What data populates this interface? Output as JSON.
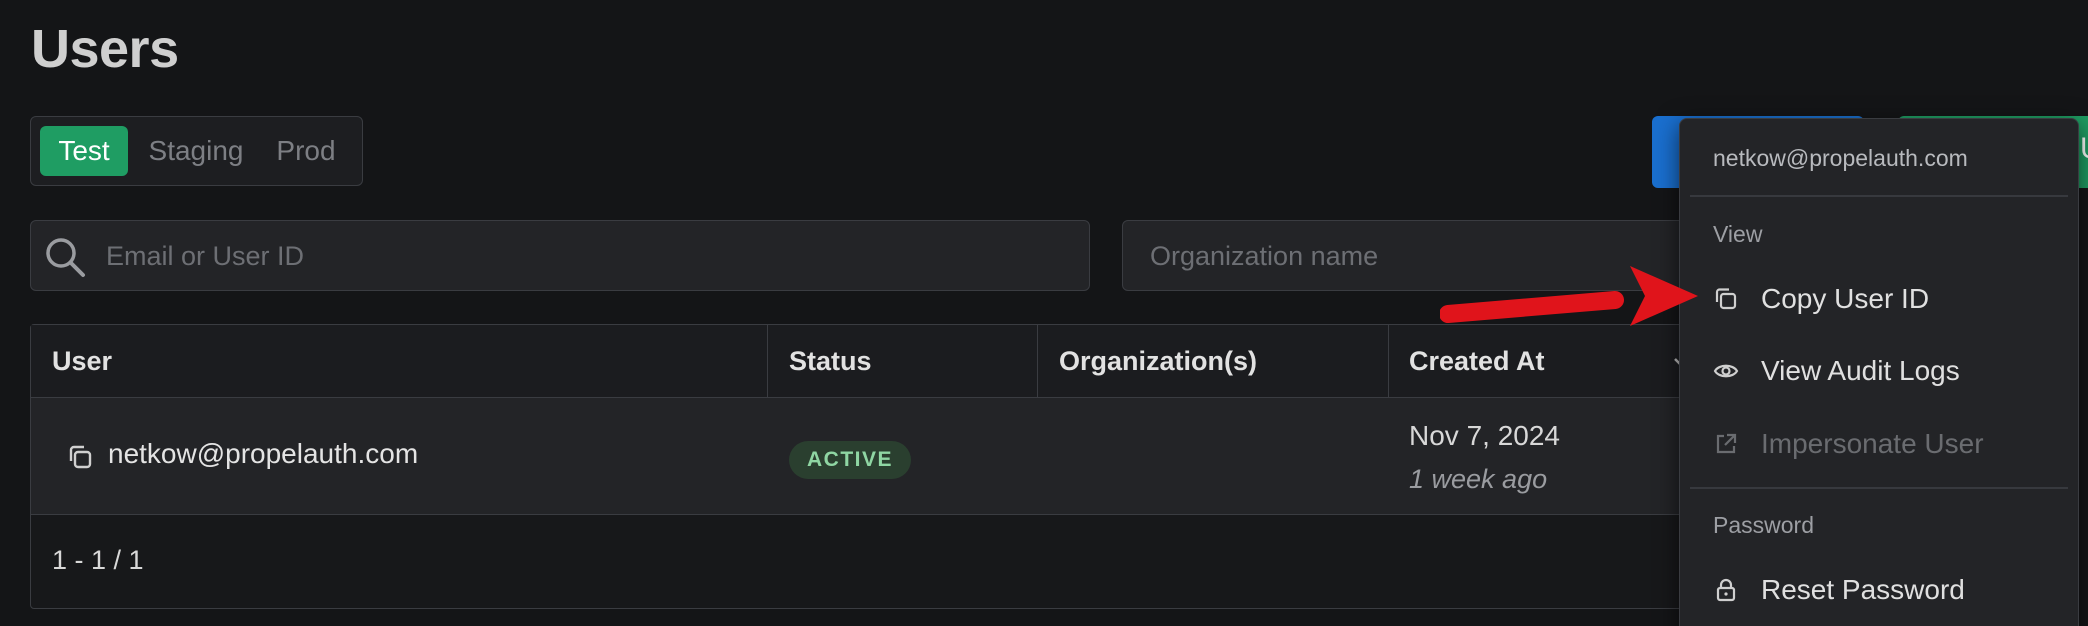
{
  "page": {
    "title": "Users"
  },
  "env_toggle": {
    "options": [
      "Test",
      "Staging",
      "Prod"
    ],
    "selected": "Test"
  },
  "search": {
    "user_placeholder": "Email or User ID",
    "org_placeholder": "Organization name"
  },
  "table": {
    "headers": [
      "User",
      "Status",
      "Organization(s)",
      "Created At"
    ],
    "rows": [
      {
        "user": "netkow@propelauth.com",
        "status": "ACTIVE",
        "organizations": "",
        "created_at": "Nov 7, 2024",
        "created_relative": "1 week ago"
      }
    ],
    "pagination": "1 - 1 / 1"
  },
  "menu": {
    "email": "netkow@propelauth.com",
    "sections": [
      {
        "title": "View",
        "items": [
          "Copy User ID",
          "View Audit Logs",
          "Impersonate User"
        ]
      },
      {
        "title": "Password",
        "items": [
          "Reset Password"
        ]
      }
    ]
  },
  "top_buttons": {
    "green_partial": "U"
  },
  "colors": {
    "accent_green": "#1f9d63",
    "accent_blue": "#1a6fcf",
    "status_active_text": "#8fd6a3",
    "annotation_red": "#e0141b"
  },
  "icons": {
    "search": "search-icon",
    "copy": "copy-icon",
    "view": "eye-icon",
    "impersonate": "external-link-icon",
    "password": "lock-icon",
    "sort": "chevron-down-icon",
    "annotation": "red-arrow-icon"
  }
}
